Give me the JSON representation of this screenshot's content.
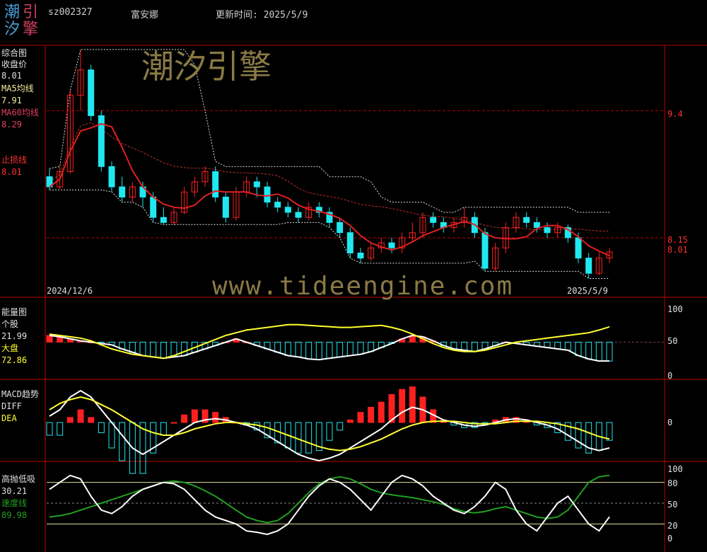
{
  "header": {
    "logo_top": [
      "潮",
      "引"
    ],
    "logo_bottom": [
      "汐",
      "擎"
    ],
    "code": "sz002327",
    "name": "富安娜",
    "update_label": "更新时间: 2025/5/9"
  },
  "watermark": {
    "brand": "潮汐引擎",
    "url": "www.tideengine.com"
  },
  "colors": {
    "up": "#ff2020",
    "down": "#20e8f0",
    "ma5": "#f0f0a0",
    "ma60": "#e04040",
    "grid": "#c00000",
    "white": "#ffffff",
    "yellow": "#ffff30",
    "green": "#20a020"
  },
  "panels": {
    "main": {
      "title": "综合图",
      "close_label": "收盘价",
      "close_value": "8.01",
      "ma5_label": "MA5均线",
      "ma5_value": "7.91",
      "ma60_label": "MA60均线",
      "ma60_value": "8.29",
      "stop_label": "止损线",
      "stop_value": "8.01",
      "date_start": "2024/12/6",
      "date_end": "2025/5/9",
      "right_labels": [
        "9.4",
        "8.15",
        "8.01"
      ]
    },
    "energy": {
      "title": "能量图",
      "stock_label": "个股",
      "stock_value": "21.99",
      "market_label": "大盘",
      "market_value": "72.86",
      "right_labels": [
        "100",
        "50",
        "0"
      ]
    },
    "macd": {
      "title": "MACD趋势",
      "diff_label": "DIFF",
      "dea_label": "DEA",
      "right_labels": [
        "0"
      ]
    },
    "gaopao": {
      "title": "高抛低吸",
      "value1": "30.21",
      "speed_label": "速度线",
      "speed_value": "89.98",
      "right_labels": [
        "100",
        "80",
        "50",
        "20",
        "0"
      ]
    }
  },
  "chart_data": [
    {
      "type": "candlestick",
      "title": "综合图",
      "x": [
        "2024/12/6",
        "2025/5/9"
      ],
      "ylim": [
        7.6,
        10.0
      ],
      "reference_lines": [
        9.4,
        8.15
      ],
      "candles": [
        [
          8.75,
          8.65,
          8.83,
          8.62
        ],
        [
          8.65,
          8.8,
          8.85,
          8.63
        ],
        [
          8.8,
          9.55,
          9.6,
          8.78
        ],
        [
          9.55,
          9.8,
          10.0,
          9.4
        ],
        [
          9.8,
          9.35,
          9.85,
          9.3
        ],
        [
          9.35,
          8.85,
          9.4,
          8.8
        ],
        [
          8.85,
          8.65,
          8.9,
          8.6
        ],
        [
          8.65,
          8.55,
          8.75,
          8.5
        ],
        [
          8.55,
          8.65,
          8.7,
          8.5
        ],
        [
          8.65,
          8.55,
          8.7,
          8.45
        ],
        [
          8.55,
          8.35,
          8.6,
          8.3
        ],
        [
          8.35,
          8.3,
          8.45,
          8.28
        ],
        [
          8.3,
          8.4,
          8.45,
          8.28
        ],
        [
          8.4,
          8.6,
          8.65,
          8.38
        ],
        [
          8.6,
          8.7,
          8.75,
          8.55
        ],
        [
          8.7,
          8.8,
          8.85,
          8.65
        ],
        [
          8.8,
          8.55,
          8.85,
          8.5
        ],
        [
          8.55,
          8.35,
          8.6,
          8.3
        ],
        [
          8.35,
          8.6,
          8.65,
          8.32
        ],
        [
          8.6,
          8.7,
          8.75,
          8.55
        ],
        [
          8.7,
          8.65,
          8.75,
          8.55
        ],
        [
          8.65,
          8.5,
          8.7,
          8.45
        ],
        [
          8.5,
          8.45,
          8.55,
          8.4
        ],
        [
          8.45,
          8.4,
          8.5,
          8.35
        ],
        [
          8.4,
          8.35,
          8.45,
          8.3
        ],
        [
          8.35,
          8.45,
          8.5,
          8.32
        ],
        [
          8.45,
          8.4,
          8.5,
          8.35
        ],
        [
          8.4,
          8.3,
          8.45,
          8.25
        ],
        [
          8.3,
          8.2,
          8.35,
          8.15
        ],
        [
          8.2,
          8.0,
          8.25,
          7.95
        ],
        [
          8.0,
          7.95,
          8.05,
          7.9
        ],
        [
          7.95,
          8.05,
          8.1,
          7.92
        ],
        [
          8.05,
          8.1,
          8.15,
          8.0
        ],
        [
          8.1,
          8.05,
          8.15,
          8.0
        ],
        [
          8.05,
          8.15,
          8.2,
          8.0
        ],
        [
          8.15,
          8.2,
          8.3,
          8.1
        ],
        [
          8.2,
          8.35,
          8.4,
          8.15
        ],
        [
          8.35,
          8.3,
          8.4,
          8.25
        ],
        [
          8.3,
          8.25,
          8.35,
          8.2
        ],
        [
          8.25,
          8.3,
          8.35,
          8.2
        ],
        [
          8.3,
          8.35,
          8.45,
          8.25
        ],
        [
          8.35,
          8.2,
          8.4,
          8.15
        ],
        [
          8.2,
          7.85,
          8.25,
          7.82
        ],
        [
          7.85,
          8.05,
          8.1,
          7.82
        ],
        [
          8.05,
          8.25,
          8.3,
          8.0
        ],
        [
          8.25,
          8.35,
          8.4,
          8.2
        ],
        [
          8.35,
          8.3,
          8.4,
          8.25
        ],
        [
          8.3,
          8.25,
          8.35,
          8.2
        ],
        [
          8.25,
          8.2,
          8.3,
          8.15
        ],
        [
          8.2,
          8.25,
          8.3,
          8.15
        ],
        [
          8.25,
          8.15,
          8.28,
          8.1
        ],
        [
          8.15,
          7.95,
          8.2,
          7.9
        ],
        [
          7.95,
          7.8,
          8.0,
          7.75
        ],
        [
          7.8,
          7.95,
          8.01,
          7.78
        ],
        [
          7.95,
          8.01,
          8.05,
          7.9
        ]
      ]
    },
    {
      "type": "bar+line",
      "title": "能量图",
      "ylim": [
        0,
        100
      ],
      "series": [
        {
          "name": "个股",
          "values": [
            60,
            58,
            55,
            52,
            50,
            48,
            46,
            40,
            35,
            30,
            28,
            26,
            28,
            30,
            35,
            40,
            45,
            50,
            55,
            50,
            45,
            40,
            35,
            30,
            28,
            25,
            24,
            26,
            28,
            30,
            32,
            36,
            42,
            48,
            55,
            60,
            58,
            52,
            45,
            40,
            38,
            36,
            40,
            45,
            50,
            48,
            46,
            44,
            42,
            40,
            38,
            30,
            25,
            22,
            21.99
          ]
        },
        {
          "name": "大盘",
          "values": [
            62,
            60,
            58,
            56,
            52,
            46,
            40,
            36,
            32,
            30,
            28,
            26,
            30,
            36,
            42,
            48,
            54,
            60,
            64,
            68,
            70,
            72,
            74,
            76,
            76,
            75,
            74,
            73,
            72,
            72,
            73,
            74,
            75,
            72,
            68,
            62,
            55,
            48,
            42,
            38,
            36,
            36,
            38,
            42,
            46,
            50,
            52,
            54,
            56,
            58,
            60,
            62,
            64,
            68,
            72.86
          ]
        }
      ]
    },
    {
      "type": "bar+line",
      "title": "MACD趋势",
      "series": [
        {
          "name": "DIFF",
          "values": [
            0.05,
            0.1,
            0.2,
            0.25,
            0.2,
            0.1,
            0.0,
            -0.1,
            -0.2,
            -0.25,
            -0.2,
            -0.15,
            -0.1,
            -0.05,
            0,
            0.02,
            0.03,
            0.02,
            0,
            -0.02,
            -0.05,
            -0.1,
            -0.15,
            -0.2,
            -0.25,
            -0.28,
            -0.3,
            -0.28,
            -0.25,
            -0.2,
            -0.15,
            -0.1,
            -0.05,
            0.02,
            0.08,
            0.12,
            0.1,
            0.06,
            0.02,
            0,
            -0.02,
            -0.03,
            -0.02,
            0,
            0.02,
            0.03,
            0.02,
            0,
            -0.02,
            -0.05,
            -0.1,
            -0.15,
            -0.2,
            -0.22,
            -0.2
          ]
        },
        {
          "name": "DEA",
          "values": [
            0.1,
            0.15,
            0.18,
            0.2,
            0.18,
            0.14,
            0.1,
            0.05,
            0,
            -0.05,
            -0.08,
            -0.1,
            -0.1,
            -0.08,
            -0.05,
            -0.03,
            -0.01,
            0,
            0,
            -0.01,
            -0.02,
            -0.04,
            -0.07,
            -0.1,
            -0.13,
            -0.16,
            -0.19,
            -0.21,
            -0.22,
            -0.21,
            -0.19,
            -0.16,
            -0.13,
            -0.09,
            -0.05,
            -0.02,
            0,
            0.01,
            0.01,
            0.01,
            0,
            -0.01,
            -0.01,
            -0.01,
            0,
            0.01,
            0.01,
            0.01,
            0,
            -0.01,
            -0.03,
            -0.05,
            -0.08,
            -0.11,
            -0.13
          ]
        }
      ]
    },
    {
      "type": "line",
      "title": "高抛低吸",
      "ylim": [
        0,
        100
      ],
      "reference_lines": [
        80,
        50,
        20
      ],
      "series": [
        {
          "name": "高抛低吸",
          "values": [
            70,
            80,
            90,
            85,
            60,
            40,
            35,
            45,
            60,
            70,
            75,
            80,
            78,
            70,
            55,
            40,
            30,
            25,
            20,
            10,
            8,
            5,
            10,
            20,
            40,
            60,
            75,
            85,
            80,
            70,
            55,
            40,
            60,
            80,
            90,
            85,
            75,
            60,
            50,
            40,
            35,
            45,
            60,
            80,
            70,
            40,
            20,
            10,
            30,
            50,
            60,
            40,
            20,
            10,
            30.21
          ]
        },
        {
          "name": "速度线",
          "values": [
            30,
            32,
            35,
            40,
            45,
            50,
            55,
            60,
            65,
            70,
            75,
            80,
            82,
            80,
            75,
            68,
            60,
            50,
            40,
            30,
            25,
            22,
            25,
            35,
            50,
            65,
            78,
            85,
            88,
            85,
            78,
            70,
            65,
            62,
            60,
            58,
            55,
            52,
            48,
            42,
            38,
            36,
            38,
            42,
            45,
            40,
            35,
            30,
            28,
            30,
            40,
            60,
            80,
            88,
            89.98
          ]
        }
      ]
    }
  ]
}
